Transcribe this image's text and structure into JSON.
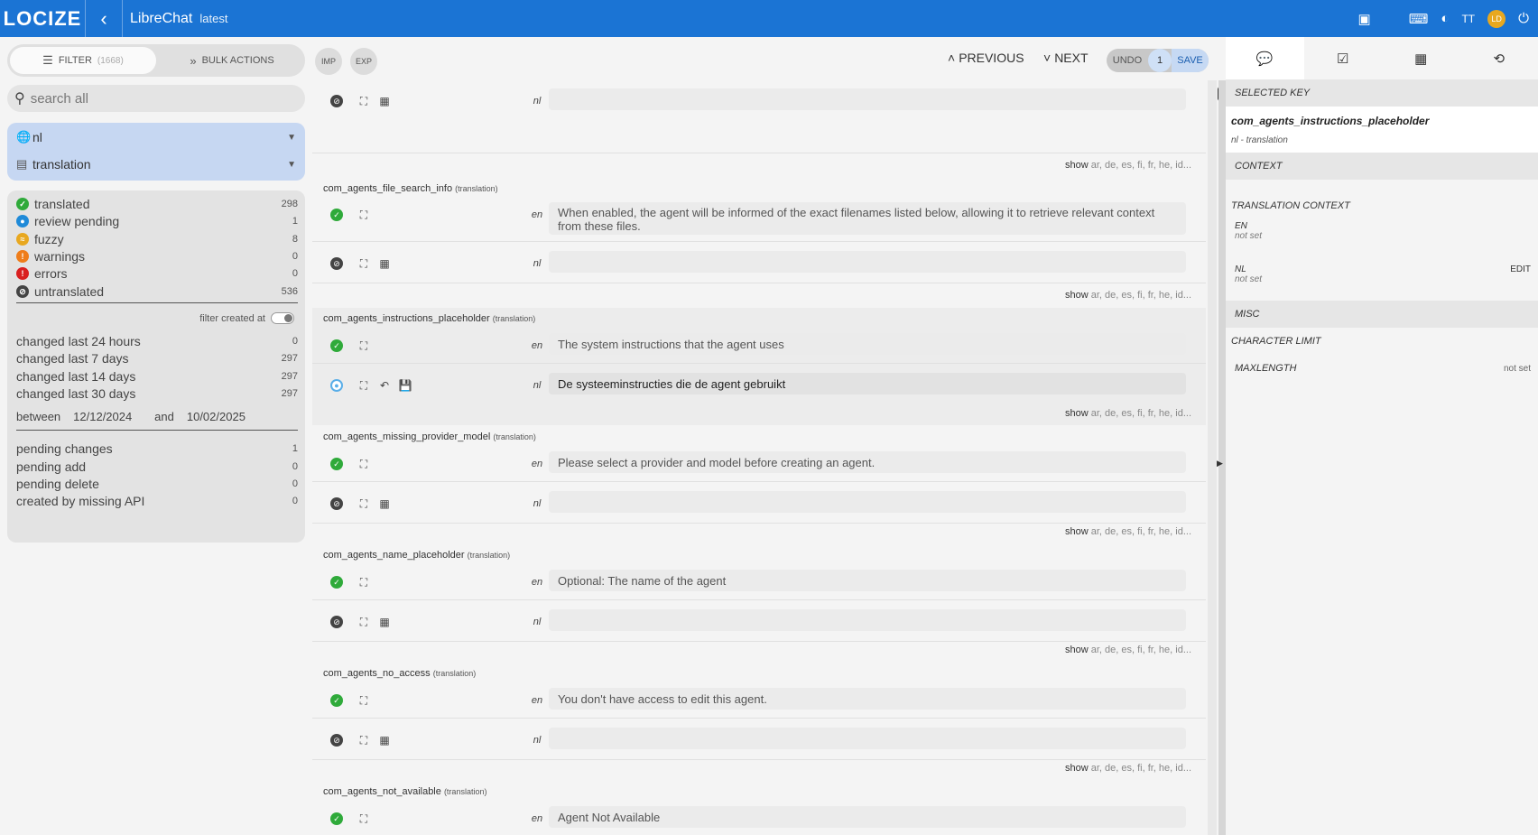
{
  "app": {
    "logo": "LOCIZE",
    "project": "LibreChat",
    "version_tag": "latest",
    "avatar_initials": "LD"
  },
  "sidebar": {
    "filter_label": "FILTER",
    "filter_count": "(1668)",
    "bulk_label": "BULK ACTIONS",
    "search_placeholder": "search all",
    "language": "nl",
    "namespace": "translation",
    "stats": [
      {
        "label": "translated",
        "count": "298",
        "color": "#2faa3a"
      },
      {
        "label": "review pending",
        "count": "1",
        "color": "#1f8ad8"
      },
      {
        "label": "fuzzy",
        "count": "8",
        "color": "#e8a820"
      },
      {
        "label": "warnings",
        "count": "0",
        "color": "#ef7d1a"
      },
      {
        "label": "errors",
        "count": "0",
        "color": "#d92020"
      },
      {
        "label": "untranslated",
        "count": "536",
        "color": "#444444"
      }
    ],
    "filter_created_label": "filter created at",
    "changes": [
      {
        "label": "changed last 24 hours",
        "count": "0"
      },
      {
        "label": "changed last 7 days",
        "count": "297"
      },
      {
        "label": "changed last 14 days",
        "count": "297"
      },
      {
        "label": "changed last 30 days",
        "count": "297"
      }
    ],
    "between_label": "between",
    "date_from": "12/12/2024",
    "and_label": "and",
    "date_to": "10/02/2025",
    "pending": [
      {
        "label": "pending changes",
        "count": "1"
      },
      {
        "label": "pending add",
        "count": "0"
      },
      {
        "label": "pending delete",
        "count": "0"
      },
      {
        "label": "created by missing API",
        "count": "0"
      }
    ]
  },
  "toolbar": {
    "imp": "IMP",
    "exp": "EXP",
    "previous": "PREVIOUS",
    "next": "NEXT",
    "undo": "UNDO",
    "pending_num": "1",
    "save": "SAVE"
  },
  "show_label": "show",
  "show_langs": "ar, de, es, fi, fr, he, id...",
  "ns_tag": "(translation)",
  "keys": [
    {
      "key": "com_agents_file_search_info",
      "en": "When enabled, the agent will be informed of the exact filenames listed below, allowing it to retrieve relevant context from these files.",
      "nl": ""
    },
    {
      "key": "com_agents_instructions_placeholder",
      "en": "The system instructions that the agent uses",
      "nl": "De systeeminstructies die de agent gebruikt"
    },
    {
      "key": "com_agents_missing_provider_model",
      "en": "Please select a provider and model before creating an agent.",
      "nl": ""
    },
    {
      "key": "com_agents_name_placeholder",
      "en": "Optional: The name of the agent",
      "nl": ""
    },
    {
      "key": "com_agents_no_access",
      "en": "You don't have access to edit this agent.",
      "nl": ""
    },
    {
      "key": "com_agents_not_available",
      "en": "Agent Not Available",
      "nl": ""
    }
  ],
  "lang_en": "en",
  "lang_nl": "nl",
  "right": {
    "selected_key_label": "SELECTED KEY",
    "selected_key": "com_agents_instructions_placeholder",
    "selected_sub": "nl - translation",
    "context_label": "CONTEXT",
    "translation_context_label": "TRANSLATION CONTEXT",
    "en_label": "EN",
    "en_value": "not set",
    "nl_label": "NL",
    "nl_value": "not set",
    "edit_label": "EDIT",
    "misc_label": "MISC",
    "char_limit_label": "CHARACTER LIMIT",
    "maxlength_label": "MAXLENGTH",
    "maxlength_value": "not set"
  }
}
